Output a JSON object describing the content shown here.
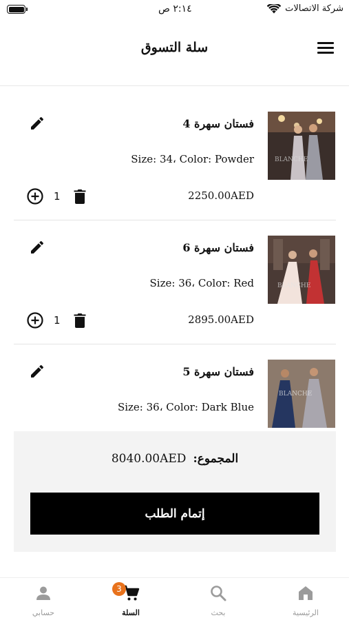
{
  "status_bar": {
    "time": "٢:١٤ ص",
    "carrier": "شركة الاتصالات"
  },
  "header": {
    "title": "سلة التسوق",
    "menu_icon": "hamburger-menu-icon"
  },
  "cart_items": [
    {
      "name": "فستان سهرة 4",
      "variant": "Size: 34، Color: Powder",
      "price": "2250.00AED",
      "quantity": "1",
      "dress_color": "#c9c2c6"
    },
    {
      "name": "فستان سهرة 6",
      "variant": "Size: 36، Color: Red",
      "price": "2895.00AED",
      "quantity": "1",
      "dress_color": "#c23233"
    },
    {
      "name": "فستان سهرة 5",
      "variant": "Size: 36، Color: Dark Blue",
      "price": "",
      "quantity": "",
      "dress_color": "#253660"
    }
  ],
  "summary": {
    "total_label": "المجموع:",
    "total_value": "8040.00AED",
    "checkout_label": "إتمام الطلب"
  },
  "tab_bar": {
    "tabs": [
      {
        "label": "حسابي",
        "icon": "person-icon",
        "active": false
      },
      {
        "label": "السلة",
        "icon": "cart-icon",
        "active": true
      },
      {
        "label": "بحث",
        "icon": "search-icon",
        "active": false
      },
      {
        "label": "الرئيسية",
        "icon": "home-icon",
        "active": false
      }
    ],
    "cart_badge": "3"
  },
  "colors": {
    "accent_badge": "#e8721c",
    "checkout_bg": "#000000",
    "summary_bg": "#f3f3f3",
    "inactive_tab": "#9b9b9b"
  }
}
